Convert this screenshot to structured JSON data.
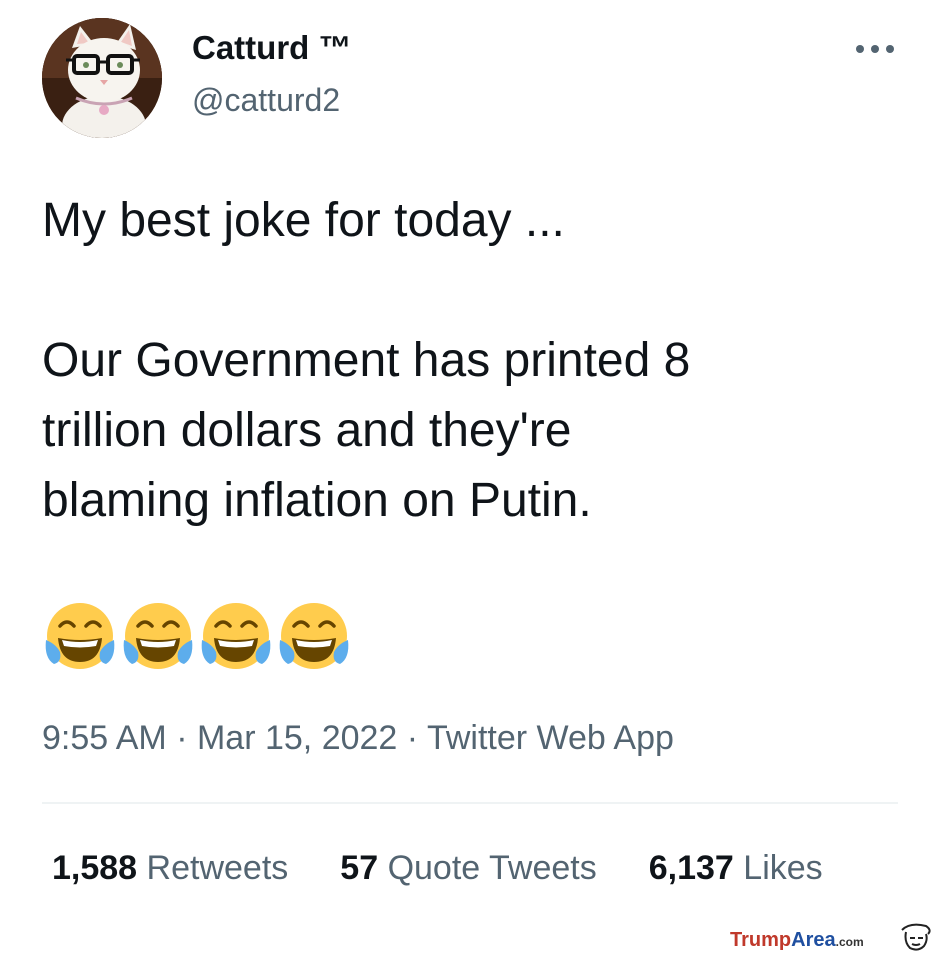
{
  "user": {
    "display_name": "Catturd ™",
    "handle": "@catturd2"
  },
  "tweet": {
    "paragraphs": [
      "My best joke for today ...",
      "Our Government has printed 8\ntrillion dollars and they're\nblaming inflation on Putin."
    ],
    "emoji": [
      "😂",
      "😂",
      "😂",
      "😂"
    ],
    "emoji_name": "face-with-tears-of-joy"
  },
  "meta": {
    "time": "9:55 AM",
    "separator": "·",
    "date": "Mar 15, 2022",
    "source": "Twitter Web App"
  },
  "stats": {
    "retweets": {
      "count": "1,588",
      "label": "Retweets"
    },
    "quotes": {
      "count": "57",
      "label": "Quote Tweets"
    },
    "likes": {
      "count": "6,137",
      "label": "Likes"
    }
  },
  "watermark": {
    "part1": "Trump",
    "part2": "Area",
    "part3": ".com"
  },
  "colors": {
    "text_primary": "#0f1419",
    "text_secondary": "#536471",
    "divider": "#eff3f4",
    "emoji_face": "#ffcc4d",
    "emoji_tears": "#5dadec"
  },
  "icons": {
    "more": "more-dots-icon",
    "avatar": "cat-with-glasses-avatar"
  }
}
